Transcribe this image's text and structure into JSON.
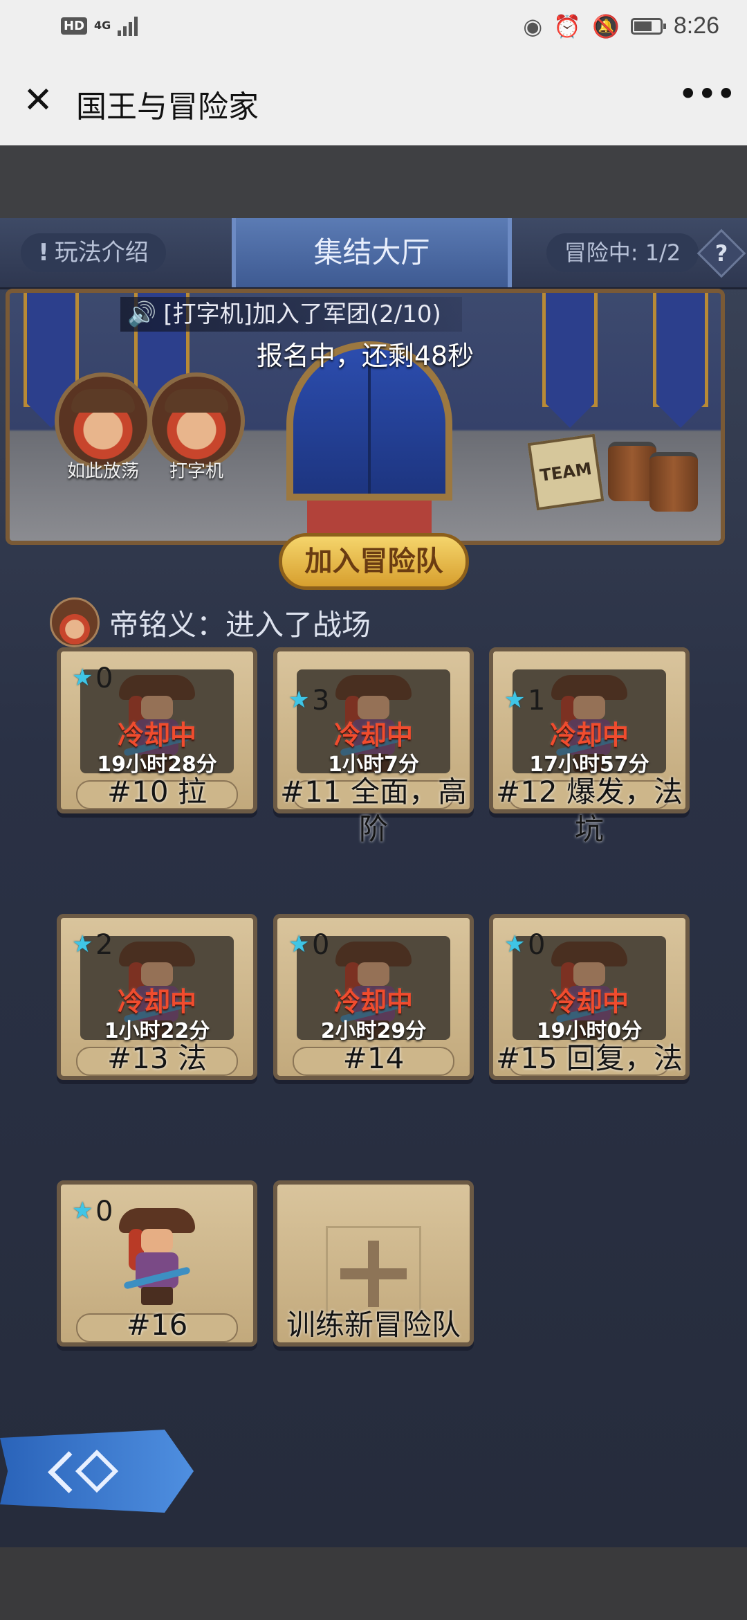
{
  "status_bar": {
    "left_badge": "HD",
    "network": "4G",
    "signal_bars": 4,
    "time": "8:26",
    "battery_level": 0.7,
    "icons": [
      "eye-icon",
      "alarm-icon",
      "mute-icon",
      "battery-icon"
    ]
  },
  "header": {
    "title": "国王与冒险家",
    "close_icon": "close-icon",
    "more_icon": "more-icon"
  },
  "tabs": {
    "left": "玩法介绍",
    "center": "集结大厅",
    "right": "冒险中: 1/2",
    "help": "?"
  },
  "hall": {
    "notice": "[打字机]加入了军团(2/10)",
    "countdown": "报名中，还剩48秒",
    "sign_text": "TEAM",
    "members": [
      {
        "name": "如此放荡"
      },
      {
        "name": "打字机"
      }
    ],
    "join_button": "加入冒险队"
  },
  "feed": {
    "text": "帝铭义：进入了战场"
  },
  "teams": [
    {
      "stars": "0",
      "status": "冷却中",
      "timer": "19小时28分",
      "name": "#10 拉"
    },
    {
      "stars": "3",
      "status": "冷却中",
      "timer": "1小时7分",
      "name": "#11 全面，高阶"
    },
    {
      "stars": "1",
      "status": "冷却中",
      "timer": "17小时57分",
      "name": "#12 爆发，法坑"
    },
    {
      "stars": "2",
      "status": "冷却中",
      "timer": "1小时22分",
      "name": "#13 法"
    },
    {
      "stars": "0",
      "status": "冷却中",
      "timer": "2小时29分",
      "name": "#14"
    },
    {
      "stars": "0",
      "status": "冷却中",
      "timer": "19小时0分",
      "name": "#15 回复，法"
    },
    {
      "stars": "0",
      "status": "",
      "timer": "",
      "name": "#16"
    }
  ],
  "add_team": {
    "label": "训练新冒险队"
  },
  "colors": {
    "status_red": "#f04c2e",
    "star_cyan": "#3fc5e6",
    "join_gold": "#f5d56c",
    "tab_active": "#5b7bb4"
  }
}
